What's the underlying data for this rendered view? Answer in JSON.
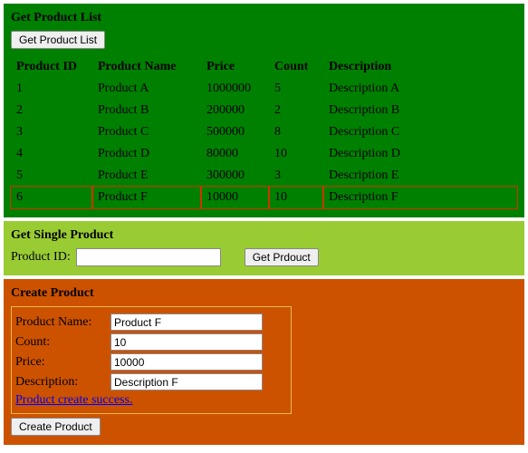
{
  "list": {
    "heading": "Get Product List",
    "button": "Get Product List",
    "columns": [
      "Product ID",
      "Product Name",
      "Price",
      "Count",
      "Description"
    ],
    "rows": [
      {
        "id": "1",
        "name": "Product A",
        "price": "1000000",
        "count": "5",
        "desc": "Description A"
      },
      {
        "id": "2",
        "name": "Product B",
        "price": "200000",
        "count": "2",
        "desc": "Description B"
      },
      {
        "id": "3",
        "name": "Product C",
        "price": "500000",
        "count": "8",
        "desc": "Description C"
      },
      {
        "id": "4",
        "name": "Product D",
        "price": "80000",
        "count": "10",
        "desc": "Description D"
      },
      {
        "id": "5",
        "name": "Product E",
        "price": "300000",
        "count": "3",
        "desc": "Description E"
      },
      {
        "id": "6",
        "name": "Product F",
        "price": "10000",
        "count": "10",
        "desc": "Description F"
      }
    ],
    "highlight_index": 5
  },
  "single": {
    "heading": "Get Single Product",
    "label": "Product ID:",
    "value": "",
    "button": "Get Prdouct"
  },
  "create": {
    "heading": "Create Product",
    "fields": {
      "name": {
        "label": "Product Name:",
        "value": "Product F"
      },
      "count": {
        "label": "Count:",
        "value": "10"
      },
      "price": {
        "label": "Price:",
        "value": "10000"
      },
      "desc": {
        "label": "Description:",
        "value": "Description F"
      }
    },
    "status": "Product create success.",
    "button": "Create Product"
  }
}
